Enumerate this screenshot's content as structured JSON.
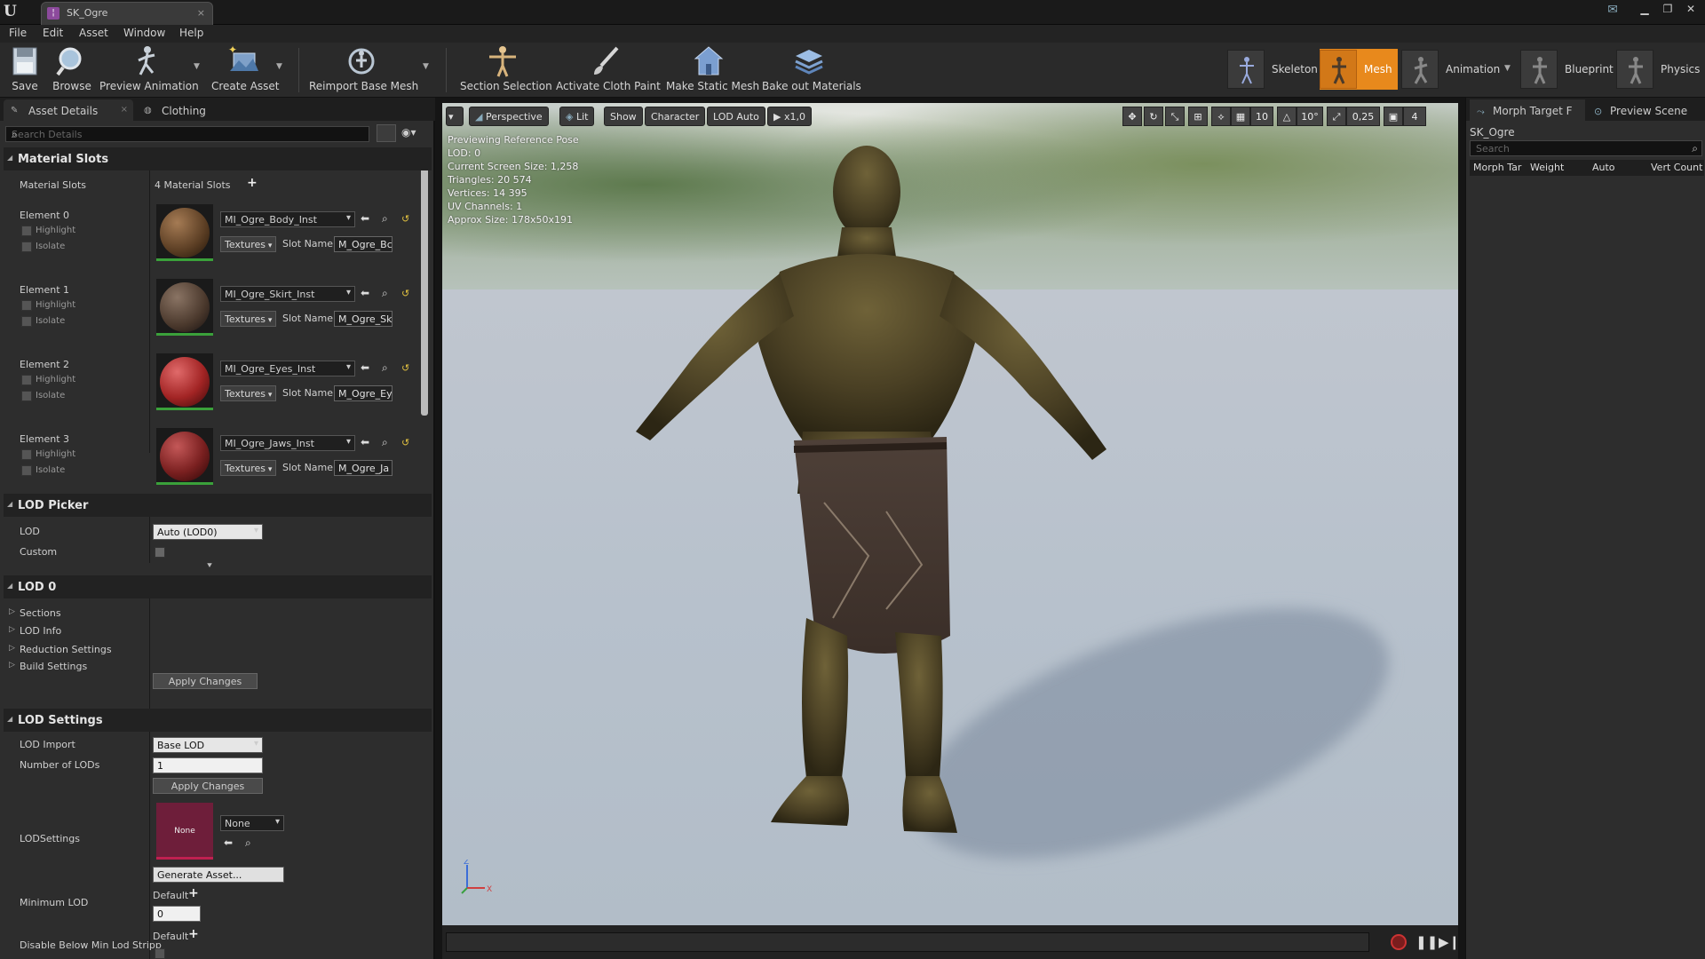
{
  "window": {
    "tab_title": "SK_Ogre",
    "close": "×"
  },
  "menu": [
    "File",
    "Edit",
    "Asset",
    "Window",
    "Help"
  ],
  "toolbar": {
    "buttons": [
      "Save",
      "Browse",
      "Preview Animation",
      "Create Asset",
      "Reimport Base Mesh",
      "Section Selection",
      "Activate Cloth Paint",
      "Make Static Mesh",
      "Bake out Materials"
    ],
    "modes": [
      "Skeleton",
      "Mesh",
      "Animation",
      "Blueprint",
      "Physics"
    ],
    "active_mode": "Mesh",
    "accent": "#e8891c"
  },
  "left_panel": {
    "tabs": [
      "Asset Details",
      "Clothing"
    ],
    "search_placeholder": "Search Details",
    "material_slots": {
      "header": "Material Slots",
      "label": "Material Slots",
      "count": "4 Material Slots",
      "highlight": "Highlight",
      "isolate": "Isolate",
      "textures": "Textures",
      "slot_name_label": "Slot Name",
      "elements": [
        {
          "name": "Element 0",
          "material": "MI_Ogre_Body_Inst",
          "slot": "M_Ogre_Bc",
          "color": "#6b4a2e"
        },
        {
          "name": "Element 1",
          "material": "MI_Ogre_Skirt_Inst",
          "slot": "M_Ogre_Sk",
          "color": "#4b3a32"
        },
        {
          "name": "Element 2",
          "material": "MI_Ogre_Eyes_Inst",
          "slot": "M_Ogre_Ey",
          "color": "#b02a2a"
        },
        {
          "name": "Element 3",
          "material": "MI_Ogre_Jaws_Inst",
          "slot": "M_Ogre_Ja",
          "color": "#7a2222"
        }
      ]
    },
    "lod_picker": {
      "header": "LOD Picker",
      "lod_label": "LOD",
      "lod_value": "Auto (LOD0)",
      "custom_label": "Custom"
    },
    "lod0": {
      "header": "LOD 0",
      "items": [
        "Sections",
        "LOD Info",
        "Reduction Settings",
        "Build Settings"
      ],
      "apply": "Apply Changes"
    },
    "lod_settings": {
      "header": "LOD Settings",
      "lod_import_label": "LOD Import",
      "lod_import_value": "Base LOD",
      "num_lods_label": "Number of LODs",
      "num_lods_value": "1",
      "apply": "Apply Changes",
      "lodsettings_label": "LODSettings",
      "none_thumb": "None",
      "none_combo": "None",
      "generate": "Generate Asset...",
      "min_lod_label": "Minimum LOD",
      "default": "Default",
      "min_lod_value": "0",
      "disable_below_label": "Disable Below Min Lod Stripp"
    }
  },
  "viewport": {
    "buttons": [
      "Perspective",
      "Lit",
      "Show",
      "Character",
      "LOD Auto",
      "x1,0"
    ],
    "right_values": [
      "10",
      "10°",
      "0,25",
      "4"
    ],
    "stats": [
      "Previewing Reference Pose",
      "LOD: 0",
      "Current Screen Size: 1,258",
      "Triangles: 20 574",
      "Vertices: 14 395",
      "UV Channels: 1",
      "Approx Size: 178x50x191"
    ],
    "axis_z": "Z",
    "axis_x": "X"
  },
  "right_panel": {
    "tabs": [
      "Morph Target F",
      "Preview Scene"
    ],
    "asset_name": "SK_Ogre",
    "search_placeholder": "Search",
    "columns": [
      "Morph Tar",
      "Weight",
      "Auto",
      "Vert Count"
    ]
  }
}
